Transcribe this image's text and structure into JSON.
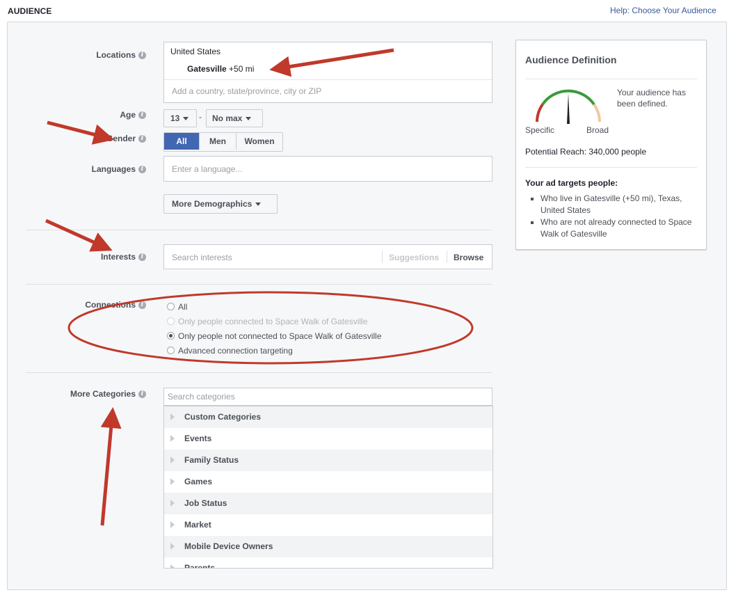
{
  "header": {
    "title": "AUDIENCE",
    "help_link": "Help: Choose Your Audience"
  },
  "form": {
    "locations": {
      "label": "Locations",
      "country": "United States",
      "city_name": "Gatesville",
      "city_radius": "+50 mi",
      "placeholder": "Add a country, state/province, city or ZIP"
    },
    "age": {
      "label": "Age",
      "min": "13",
      "separator": "-",
      "max": "No max"
    },
    "gender": {
      "label": "Gender",
      "options": [
        "All",
        "Men",
        "Women"
      ],
      "selected": "All"
    },
    "languages": {
      "label": "Languages",
      "placeholder": "Enter a language..."
    },
    "more_demographics": "More Demographics",
    "interests": {
      "label": "Interests",
      "placeholder": "Search interests",
      "suggestions": "Suggestions",
      "browse": "Browse"
    },
    "connections": {
      "label": "Connections",
      "options": [
        {
          "label": "All",
          "selected": false,
          "disabled": false
        },
        {
          "label": "Only people connected to Space Walk of Gatesville",
          "selected": false,
          "disabled": true
        },
        {
          "label": "Only people not connected to Space Walk of Gatesville",
          "selected": true,
          "disabled": false
        },
        {
          "label": "Advanced connection targeting",
          "selected": false,
          "disabled": false
        }
      ]
    },
    "more_categories": {
      "label": "More Categories",
      "placeholder": "Search categories",
      "items": [
        "Custom Categories",
        "Events",
        "Family Status",
        "Games",
        "Job Status",
        "Market",
        "Mobile Device Owners",
        "Parents"
      ]
    }
  },
  "audience_definition": {
    "title": "Audience Definition",
    "status": "Your audience has been defined.",
    "gauge": {
      "left_label": "Specific",
      "right_label": "Broad",
      "level": 0.5
    },
    "potential_reach": "Potential Reach: 340,000 people",
    "targets_title": "Your ad targets people:",
    "targets": [
      "Who live in Gatesville (+50 mi), Texas, United States",
      "Who are not already connected to Space Walk of Gatesville"
    ]
  },
  "colors": {
    "primary": "#4267b2",
    "link": "#3b5998",
    "annotation": "#c0392b",
    "gauge_green": "#3a9a3a",
    "gauge_red": "#c0392b",
    "gauge_tan": "#f1c9a0"
  },
  "icons": {
    "info": "info-icon",
    "dropdown": "caret-down-icon",
    "expand": "triangle-right-icon"
  }
}
